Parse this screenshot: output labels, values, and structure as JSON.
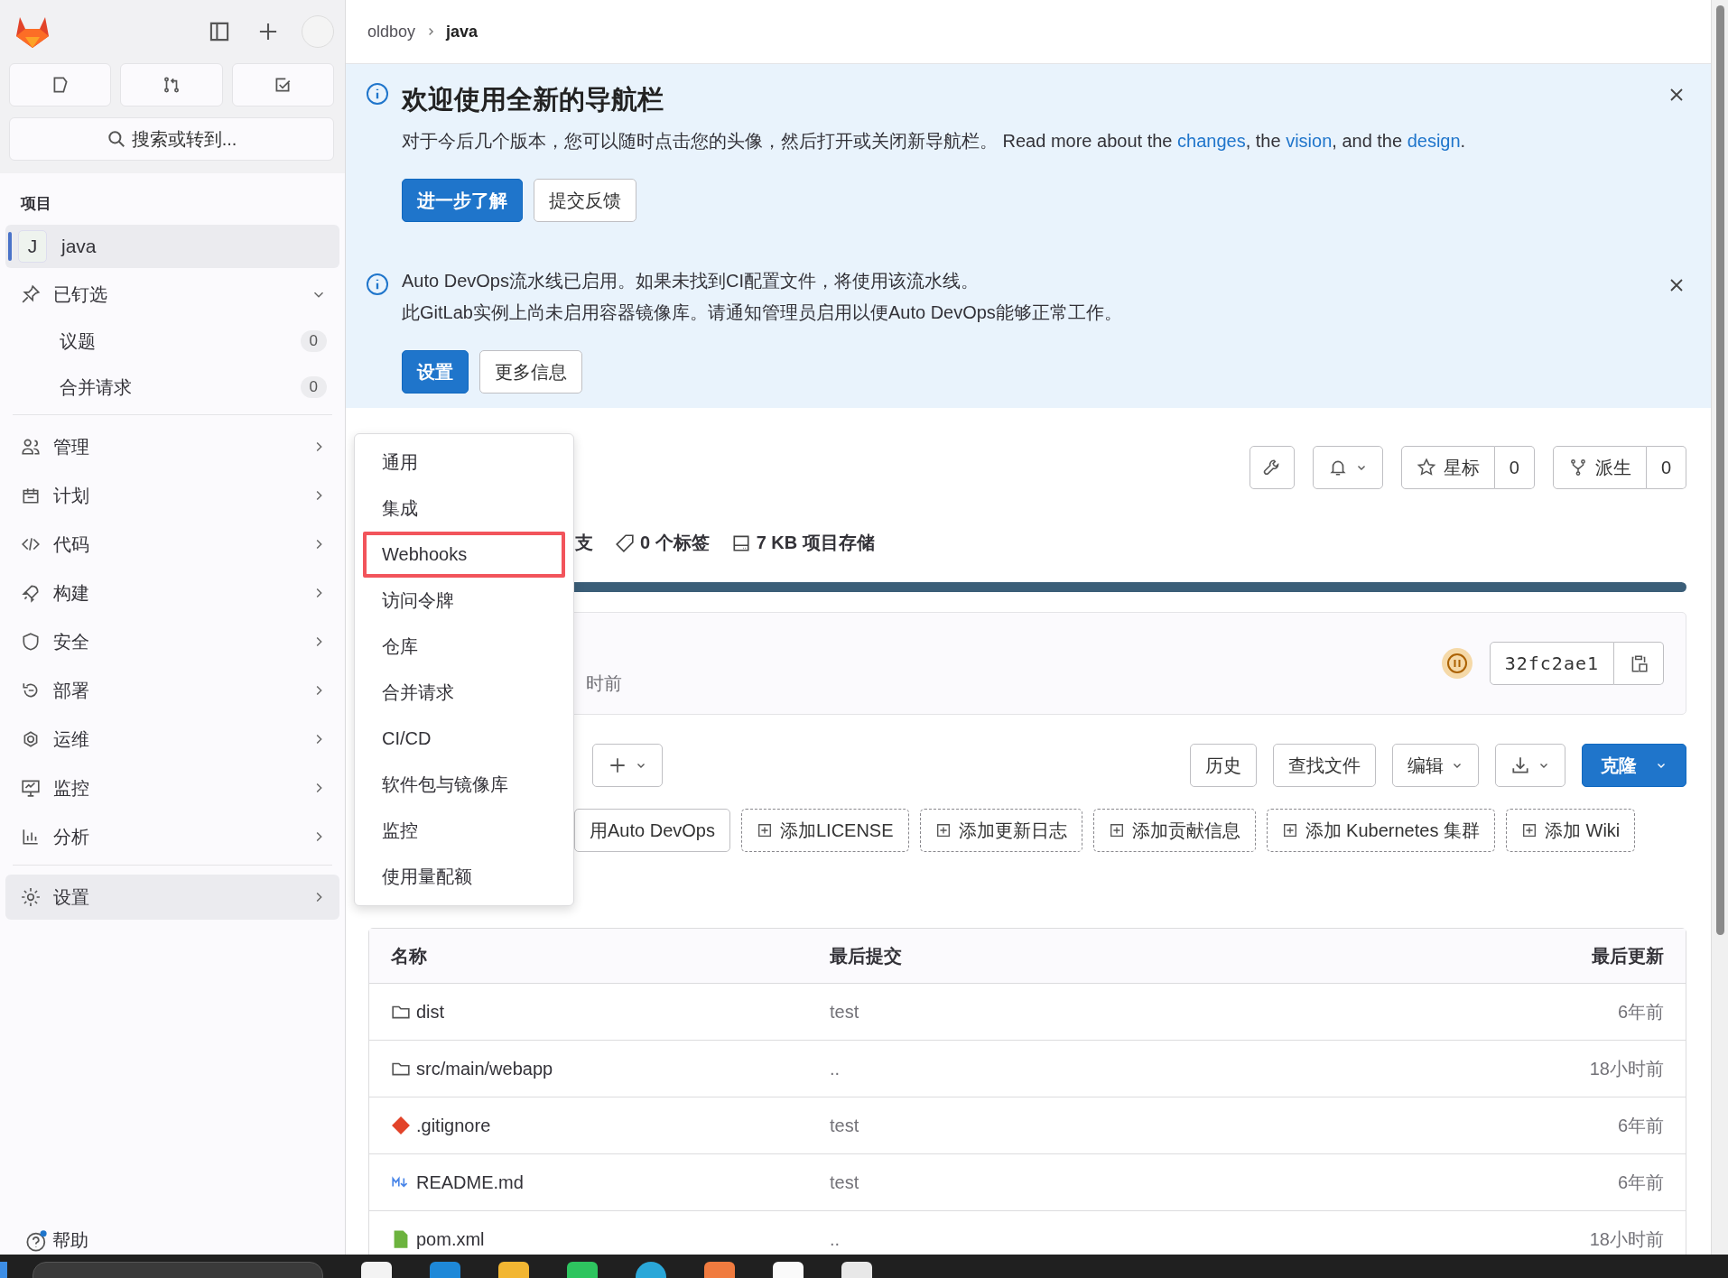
{
  "sidebar": {
    "search": {
      "label": "搜索或转到..."
    },
    "section_title": "项目",
    "project": {
      "initial": "J",
      "name": "java",
      "selected": true
    },
    "pinned": {
      "label": "已钉选",
      "expanded": true,
      "items": [
        {
          "label": "议题",
          "count": "0"
        },
        {
          "label": "合并请求",
          "count": "0"
        }
      ]
    },
    "nav": [
      {
        "label": "管理",
        "selected": false
      },
      {
        "label": "计划",
        "selected": false
      },
      {
        "label": "代码",
        "selected": false
      },
      {
        "label": "构建",
        "selected": false
      },
      {
        "label": "安全",
        "selected": false
      },
      {
        "label": "部署",
        "selected": false
      },
      {
        "label": "运维",
        "selected": false
      },
      {
        "label": "监控",
        "selected": false
      },
      {
        "label": "分析",
        "selected": false
      }
    ],
    "settings": {
      "label": "设置",
      "selected": true
    },
    "help": {
      "label": "帮助",
      "unread": true
    }
  },
  "breadcrumb": [
    "oldboy",
    "java"
  ],
  "alerts": [
    {
      "title": "欢迎使用全新的导航栏",
      "lines": [
        [
          {
            "text": "对于今后几个版本，您可以随时点击您的头像，然后打开或关闭新导航栏。 Read more about the ",
            "link": false
          },
          {
            "text": "changes",
            "link": true
          },
          {
            "text": ", the ",
            "link": false
          },
          {
            "text": "vision",
            "link": true
          },
          {
            "text": ", and the ",
            "link": false
          },
          {
            "text": "design",
            "link": true
          },
          {
            "text": ".",
            "link": false
          }
        ]
      ],
      "buttons": [
        {
          "label": "进一步了解",
          "primary": true
        },
        {
          "label": "提交反馈",
          "primary": false
        }
      ]
    },
    {
      "lines": [
        [
          {
            "text": "Auto DevOps流水线已启用。如果未找到CI配置文件，将使用该流水线。",
            "link": false
          }
        ],
        [
          {
            "text": "此GitLab实例上尚未启用容器镜像库。请通知管理员启用以便Auto DevOps能够正常工作。",
            "link": false
          }
        ]
      ],
      "buttons": [
        {
          "label": "设置",
          "primary": true
        },
        {
          "label": "更多信息",
          "primary": false
        }
      ]
    }
  ],
  "project_actions": {
    "star": {
      "label": "星标",
      "count": "0"
    },
    "fork": {
      "label": "派生",
      "count": "0"
    }
  },
  "stats": [
    "支",
    "0 个标签",
    "7 KB 项目存储"
  ],
  "commit": {
    "time": "时前",
    "sha": "32fc2ae1"
  },
  "toolbar": [
    {
      "label": "历史",
      "kind": "plain"
    },
    {
      "label": "查找文件",
      "kind": "plain"
    },
    {
      "label": "编辑",
      "kind": "dropdown"
    },
    {
      "kind": "download"
    },
    {
      "label": "克隆",
      "kind": "primary"
    }
  ],
  "quick_actions": [
    {
      "label": "用Auto DevOps",
      "kind": "solid"
    },
    {
      "label": "添加LICENSE",
      "kind": "dashed"
    },
    {
      "label": "添加更新日志",
      "kind": "dashed"
    },
    {
      "label": "添加贡献信息",
      "kind": "dashed"
    },
    {
      "label": "添加 Kubernetes 集群",
      "kind": "dashed"
    },
    {
      "label": "添加 Wiki",
      "kind": "dashed"
    }
  ],
  "table": {
    "columns": [
      "名称",
      "最后提交",
      "最后更新"
    ],
    "rows": [
      {
        "name": "dist",
        "kind": "folder",
        "commit": "test",
        "updated": "6年前"
      },
      {
        "name": "src/main/webapp",
        "kind": "folder",
        "commit": "..",
        "updated": "18小时前"
      },
      {
        "name": ".gitignore",
        "kind": "git",
        "commit": "test",
        "updated": "6年前"
      },
      {
        "name": "README.md",
        "kind": "markdown",
        "commit": "test",
        "updated": "6年前"
      },
      {
        "name": "pom.xml",
        "kind": "xml",
        "commit": "..",
        "updated": "18小时前"
      }
    ]
  },
  "settings_menu": [
    {
      "label": "通用",
      "highlighted": false
    },
    {
      "label": "集成",
      "highlighted": false
    },
    {
      "label": "Webhooks",
      "highlighted": true
    },
    {
      "label": "访问令牌",
      "highlighted": false
    },
    {
      "label": "仓库",
      "highlighted": false
    },
    {
      "label": "合并请求",
      "highlighted": false
    },
    {
      "label": "CI/CD",
      "highlighted": false
    },
    {
      "label": "软件包与镜像库",
      "highlighted": false
    },
    {
      "label": "监控",
      "highlighted": false
    },
    {
      "label": "使用量配额",
      "highlighted": false
    }
  ]
}
